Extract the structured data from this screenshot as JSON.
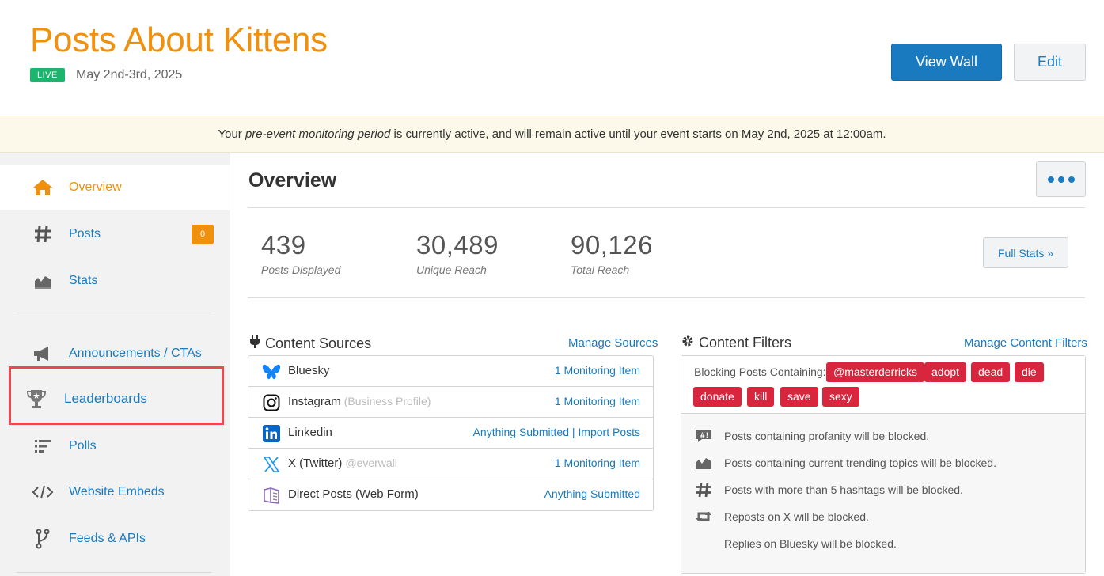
{
  "header": {
    "title": "Posts About Kittens",
    "status_badge": "LIVE",
    "date": "May 2nd-3rd, 2025",
    "view_wall_label": "View Wall",
    "edit_label": "Edit"
  },
  "banner": {
    "prefix": "Your ",
    "emphasis": "pre-event monitoring period",
    "suffix": " is currently active, and will remain active until your event starts on May 2nd, 2025 at 12:00am."
  },
  "sidebar": {
    "items": [
      {
        "label": "Overview",
        "icon": "home-icon",
        "active": true
      },
      {
        "label": "Posts",
        "icon": "hashtag-icon",
        "badge": "0"
      },
      {
        "label": "Stats",
        "icon": "stats-chart-icon"
      },
      {
        "label": "Announcements / CTAs",
        "icon": "megaphone-icon"
      },
      {
        "label": "Leaderboards",
        "icon": "trophy-icon"
      },
      {
        "label": "Polls",
        "icon": "poll-list-icon"
      },
      {
        "label": "Website Embeds",
        "icon": "code-icon"
      },
      {
        "label": "Feeds & APIs",
        "icon": "fork-icon"
      }
    ]
  },
  "main": {
    "title": "Overview",
    "stats": [
      {
        "value": "439",
        "label": "Posts Displayed"
      },
      {
        "value": "30,489",
        "label": "Unique Reach"
      },
      {
        "value": "90,126",
        "label": "Total Reach"
      }
    ],
    "full_stats_label": "Full Stats »"
  },
  "content_sources": {
    "title": "Content Sources",
    "manage_label": "Manage Sources",
    "rows": [
      {
        "name": "Bluesky",
        "sub": "",
        "link": "1 Monitoring Item",
        "icon": "bluesky-icon"
      },
      {
        "name": "Instagram",
        "sub": "(Business Profile)",
        "link": "1 Monitoring Item",
        "icon": "instagram-icon"
      },
      {
        "name": "Linkedin",
        "sub": "",
        "link": "Anything Submitted | Import Posts",
        "icon": "linkedin-icon"
      },
      {
        "name": "X (Twitter)",
        "sub": "@everwall",
        "link": "1 Monitoring Item",
        "icon": "x-twitter-icon"
      },
      {
        "name": "Direct Posts (Web Form)",
        "sub": "",
        "link": "Anything Submitted",
        "icon": "direct-posts-icon"
      }
    ]
  },
  "content_filters": {
    "title": "Content Filters",
    "manage_label": "Manage Content Filters",
    "blocking_label": "Blocking Posts Containing:",
    "tags": [
      "@masterderricks",
      "adopt",
      "dead",
      "die",
      "donate",
      "kill",
      "save",
      "sexy"
    ],
    "rules": [
      {
        "text": "Posts containing profanity will be blocked.",
        "icon": "profanity-icon"
      },
      {
        "text": "Posts containing current trending topics will be blocked.",
        "icon": "trending-chart-icon"
      },
      {
        "text": "Posts with more than 5 hashtags will be blocked.",
        "icon": "hashtag-icon"
      },
      {
        "text": "Reposts on X will be blocked.",
        "icon": "repost-icon"
      },
      {
        "text": "Replies on Bluesky will be blocked.",
        "icon": ""
      }
    ]
  },
  "colors": {
    "accent_orange": "#f0900f",
    "link_blue": "#1a7abf",
    "live_green": "#1db56e",
    "tag_red": "#d7263d",
    "highlight_red": "#ea4a4f"
  }
}
